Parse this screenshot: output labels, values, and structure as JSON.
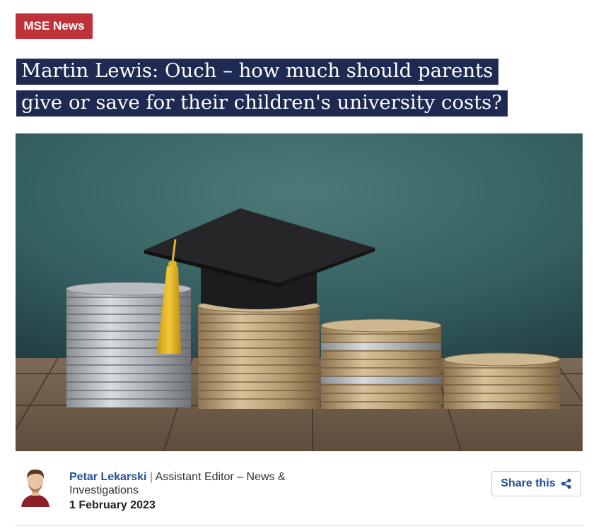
{
  "badge": {
    "label": "MSE News",
    "color": "#c0323a"
  },
  "headline": {
    "line1": "Martin Lewis: Ouch – how much should parents",
    "line2": "give or save for their children's university costs?",
    "highlight_color": "#1f2a52"
  },
  "hero_image": {
    "subject": "graduation-cap-on-coin-stacks"
  },
  "author": {
    "name": "Petar Lekarski",
    "separator": " | ",
    "role": "Assistant Editor – News & Investigations",
    "date": "1 February 2023"
  },
  "share": {
    "label": "Share this",
    "icon": "share-icon"
  }
}
